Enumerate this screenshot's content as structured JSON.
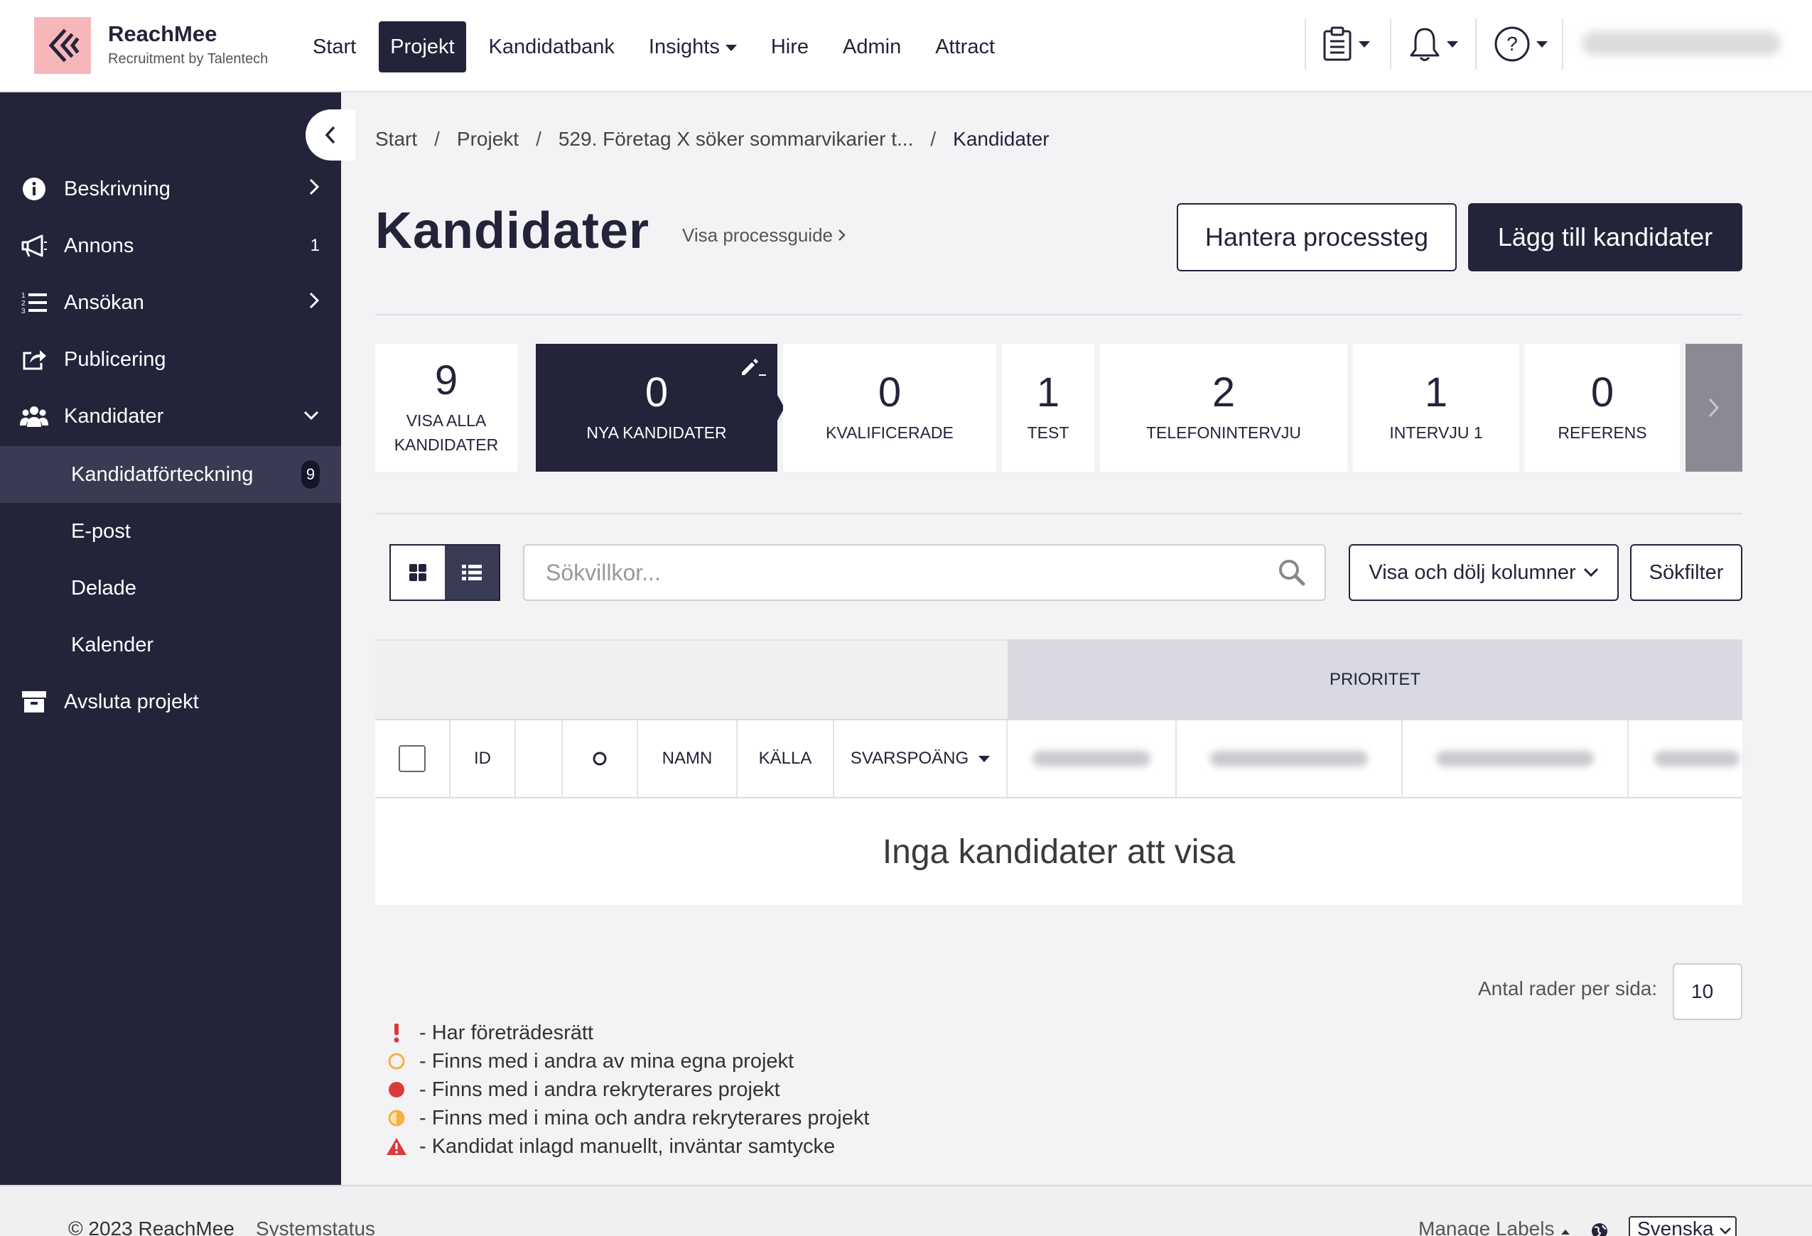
{
  "brand": {
    "name": "ReachMee",
    "subtitle": "Recruitment by Talentech"
  },
  "nav": {
    "items": [
      {
        "label": "Start"
      },
      {
        "label": "Projekt",
        "active": true
      },
      {
        "label": "Kandidatbank"
      },
      {
        "label": "Insights",
        "dropdown": true
      },
      {
        "label": "Hire"
      },
      {
        "label": "Admin"
      },
      {
        "label": "Attract"
      }
    ],
    "icons": [
      "clipboard-icon",
      "bell-icon",
      "help-icon"
    ]
  },
  "sidebar": {
    "items": [
      {
        "label": "Beskrivning",
        "icon": "info-icon",
        "right": "chevron"
      },
      {
        "label": "Annons",
        "icon": "megaphone-icon",
        "right": "1"
      },
      {
        "label": "Ansökan",
        "icon": "list-icon",
        "right": "chevron"
      },
      {
        "label": "Publicering",
        "icon": "share-icon",
        "right": ""
      },
      {
        "label": "Kandidater",
        "icon": "users-icon",
        "right": "chevron-down"
      }
    ],
    "subitems": [
      {
        "label": "Kandidatförteckning",
        "badge": "9",
        "active": true
      },
      {
        "label": "E-post"
      },
      {
        "label": "Delade"
      },
      {
        "label": "Kalender"
      }
    ],
    "close_project": {
      "label": "Avsluta projekt",
      "icon": "archive-icon"
    }
  },
  "breadcrumb": {
    "items": [
      "Start",
      "Projekt",
      "529. Företag X söker sommarvikarier t..."
    ],
    "current": "Kandidater"
  },
  "page": {
    "title": "Kandidater",
    "guide_link": "Visa processguide",
    "btn_manage": "Hantera processteg",
    "btn_add": "Lägg till kandidater"
  },
  "stages": [
    {
      "count": "9",
      "name_line1": "VISA ALLA",
      "name_line2": "KANDIDATER"
    },
    {
      "count": "0",
      "name_line1": "NYA KANDIDATER",
      "name_line2": "",
      "active": true
    },
    {
      "count": "0",
      "name_line1": "KVALIFICERADE",
      "name_line2": ""
    },
    {
      "count": "1",
      "name_line1": "TEST",
      "name_line2": ""
    },
    {
      "count": "2",
      "name_line1": "TELEFONINTERVJU",
      "name_line2": ""
    },
    {
      "count": "1",
      "name_line1": "INTERVJU 1",
      "name_line2": ""
    },
    {
      "count": "0",
      "name_line1": "REFERENS",
      "name_line2": ""
    }
  ],
  "toolbar": {
    "search_placeholder": "Sökvillkor...",
    "columns_label": "Visa och dölj kolumner",
    "filter_label": "Sökfilter"
  },
  "table": {
    "group_header": "PRIORITET",
    "columns": [
      "ID",
      "",
      "O",
      "NAMN",
      "KÄLLA",
      "SVARSPOÄNG"
    ],
    "empty_message": "Inga kandidater att visa"
  },
  "pagination": {
    "rows_label": "Antal rader per sida:",
    "rows_value": "10"
  },
  "legend": [
    {
      "icon": "exclamation-icon",
      "text": "- Har företrädesrätt"
    },
    {
      "icon": "ring-icon",
      "text": "- Finns med i andra av mina egna projekt"
    },
    {
      "icon": "dot-red-icon",
      "text": "- Finns med i andra rekryterares projekt"
    },
    {
      "icon": "half-circle-icon",
      "text": "- Finns med i mina och andra rekryterares projekt"
    },
    {
      "icon": "warning-icon",
      "text": "- Kandidat inlagd manuellt, inväntar samtycke"
    }
  ],
  "footer": {
    "copyright": "© 2023 ReachMee",
    "status": "Systemstatus",
    "manage_labels": "Manage Labels",
    "language": "Svenska"
  },
  "colors": {
    "primary": "#23243a",
    "sidebar": "#23243a",
    "logo_bg": "#f6b7bb",
    "accent_red": "#d93a3a",
    "accent_orange": "#f4b23e"
  }
}
